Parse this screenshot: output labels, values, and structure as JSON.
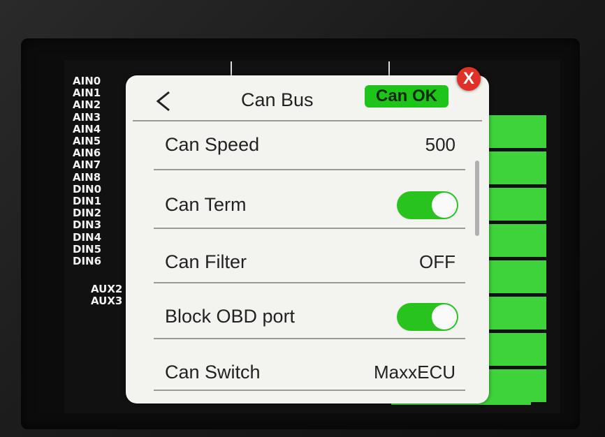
{
  "channels": {
    "items": [
      "AIN0",
      "AIN1",
      "AIN2",
      "AIN3",
      "AIN4",
      "AIN5",
      "AIN6",
      "AIN7",
      "AIN8",
      "DIN0",
      "DIN1",
      "DIN2",
      "DIN3",
      "DIN4",
      "DIN5",
      "DIN6"
    ],
    "aux": [
      "AUX2",
      "AUX3"
    ]
  },
  "dialog": {
    "back_icon": "chevron-left-icon",
    "title": "Can Bus",
    "status_badge": "Can OK",
    "close_label": "X",
    "accent_color": "#28c31f",
    "close_color": "#e03128",
    "rows": [
      {
        "label": "Can Speed",
        "value": "500"
      },
      {
        "label": "Can Term",
        "toggle_on": true
      },
      {
        "label": "Can Filter",
        "value": "OFF"
      },
      {
        "label": "Block OBD port",
        "toggle_on": true
      },
      {
        "label": "Can Switch",
        "value": "MaxxECU"
      }
    ]
  }
}
